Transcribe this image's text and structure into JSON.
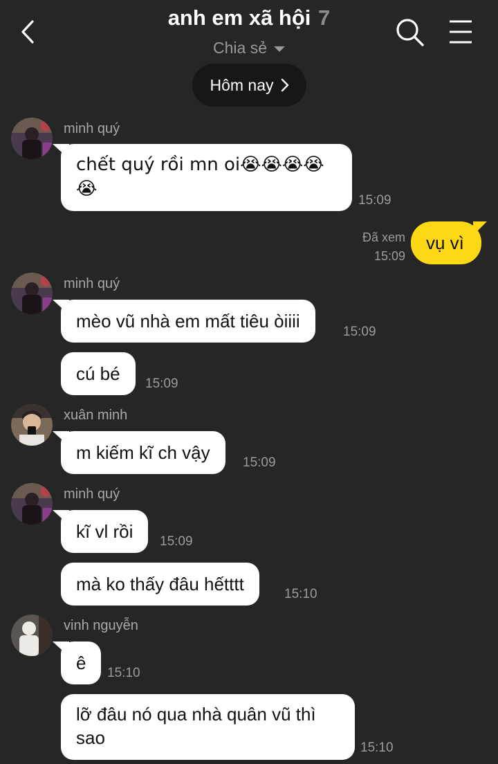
{
  "header": {
    "title": "anh em xã hội",
    "member_count": "7",
    "subtitle": "Chia sẻ",
    "icons": {
      "back": "chevron-left-icon",
      "search": "search-icon",
      "menu": "hamburger-menu-icon"
    }
  },
  "date_pill": {
    "label": "Hôm nay",
    "icon": "chevron-right-icon"
  },
  "colors": {
    "background": "#262626",
    "bubble_incoming": "#ffffff",
    "bubble_outgoing": "#fcd815",
    "meta_text": "#9c9c9c"
  },
  "messages": [
    {
      "sender": "minh quý",
      "text": "chết quý rồi mn oi😭😭😭😭😭",
      "time": "15:09"
    },
    {
      "outgoing": true,
      "text": "vụ vì",
      "status": "Đã xem",
      "time": "15:09"
    },
    {
      "sender": "minh quý",
      "text": "mèo vũ nhà em mất tiêu òiiii",
      "time": "15:09"
    },
    {
      "text": "cú bé",
      "time": "15:09"
    },
    {
      "sender": "xuân minh",
      "text": "m kiếm kĩ ch vậy",
      "time": "15:09"
    },
    {
      "sender": "minh quý",
      "text": "kĩ vl rồi",
      "time": "15:09"
    },
    {
      "text": "mà ko thấy đâu hếtttt",
      "time": "15:10"
    },
    {
      "sender": "vinh nguyễn",
      "text": "ê",
      "time": "15:10"
    },
    {
      "text": "lỡ đâu nó qua nhà quân vũ thì sao",
      "time": "15:10"
    }
  ]
}
